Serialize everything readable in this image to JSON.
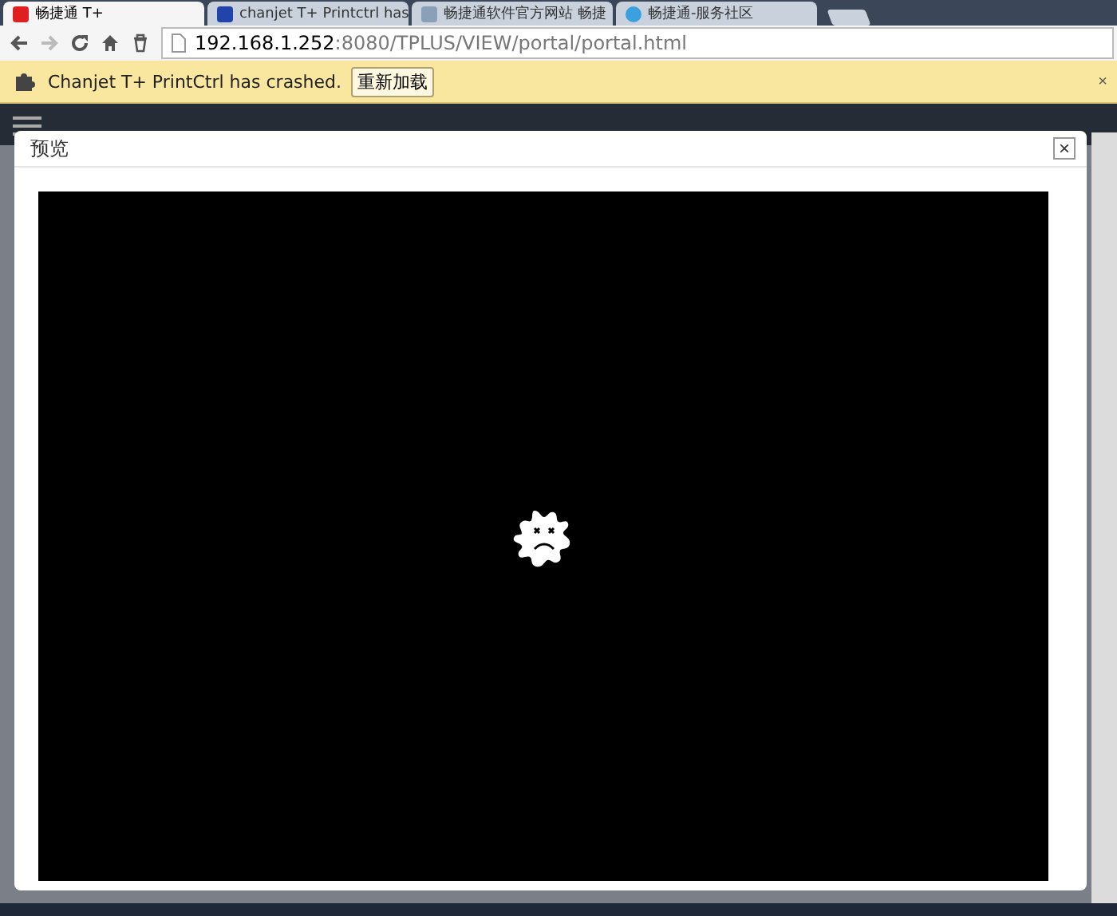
{
  "browser": {
    "tabs": [
      {
        "title": "畅捷通 T+",
        "selected": true
      },
      {
        "title": "chanjet T+ Printctrl has",
        "selected": false
      },
      {
        "title": "畅捷通软件官方网站 畅捷",
        "selected": false
      },
      {
        "title": "畅捷通-服务社区",
        "selected": false
      }
    ],
    "address": {
      "host": "192.168.1.252",
      "rest": ":8080/TPLUS/VIEW/portal/portal.html"
    }
  },
  "infobar": {
    "message": "Chanjet T+ PrintCtrl has crashed.",
    "button": "重新加载",
    "close": "×"
  },
  "dialog": {
    "title": "预览",
    "close": "×"
  }
}
